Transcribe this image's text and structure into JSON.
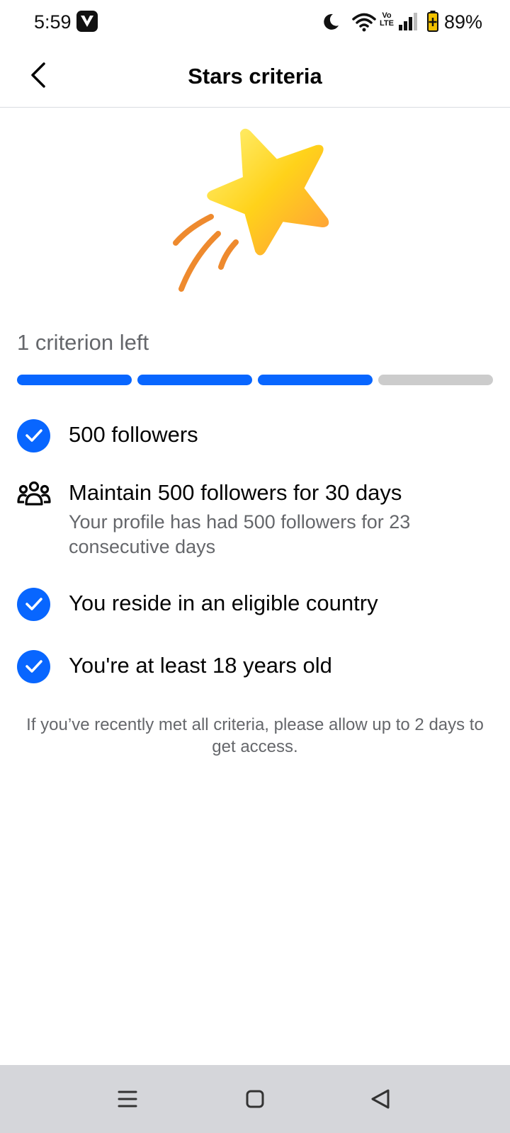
{
  "status_bar": {
    "time": "5:59",
    "volte": "Vo LTE",
    "battery_percent": "89%",
    "icons": [
      "v-app-icon",
      "moon-icon",
      "wifi-icon",
      "volte-icon",
      "signal-icon",
      "battery-icon"
    ]
  },
  "header": {
    "title": "Stars criteria",
    "back_icon": "back-arrow-icon"
  },
  "hero": {
    "icon": "shooting-star-icon"
  },
  "criteria": {
    "remaining_label": "1 criterion left",
    "progress": {
      "segments_total": 4,
      "segments_complete": 3
    },
    "items": [
      {
        "icon": "check-circle-icon",
        "title": "500 followers",
        "completed": true
      },
      {
        "icon": "people-icon",
        "title": "Maintain 500 followers for 30 days",
        "subtitle": "Your profile has had 500 followers for 23 consecutive days",
        "completed": false
      },
      {
        "icon": "check-circle-icon",
        "title": "You reside in an eligible country",
        "completed": true
      },
      {
        "icon": "check-circle-icon",
        "title": "You're at least 18 years old",
        "completed": true
      }
    ],
    "footnote": "If you’ve recently met all criteria, please allow up to 2 days to get access."
  },
  "nav_bar": {
    "icons": [
      "menu-icon",
      "home-square-icon",
      "back-triangle-icon"
    ]
  },
  "colors": {
    "accent": "#0866ff",
    "progress_inactive": "#cccccc",
    "secondary_text": "#65676b",
    "nav_background": "#d5d6da"
  }
}
